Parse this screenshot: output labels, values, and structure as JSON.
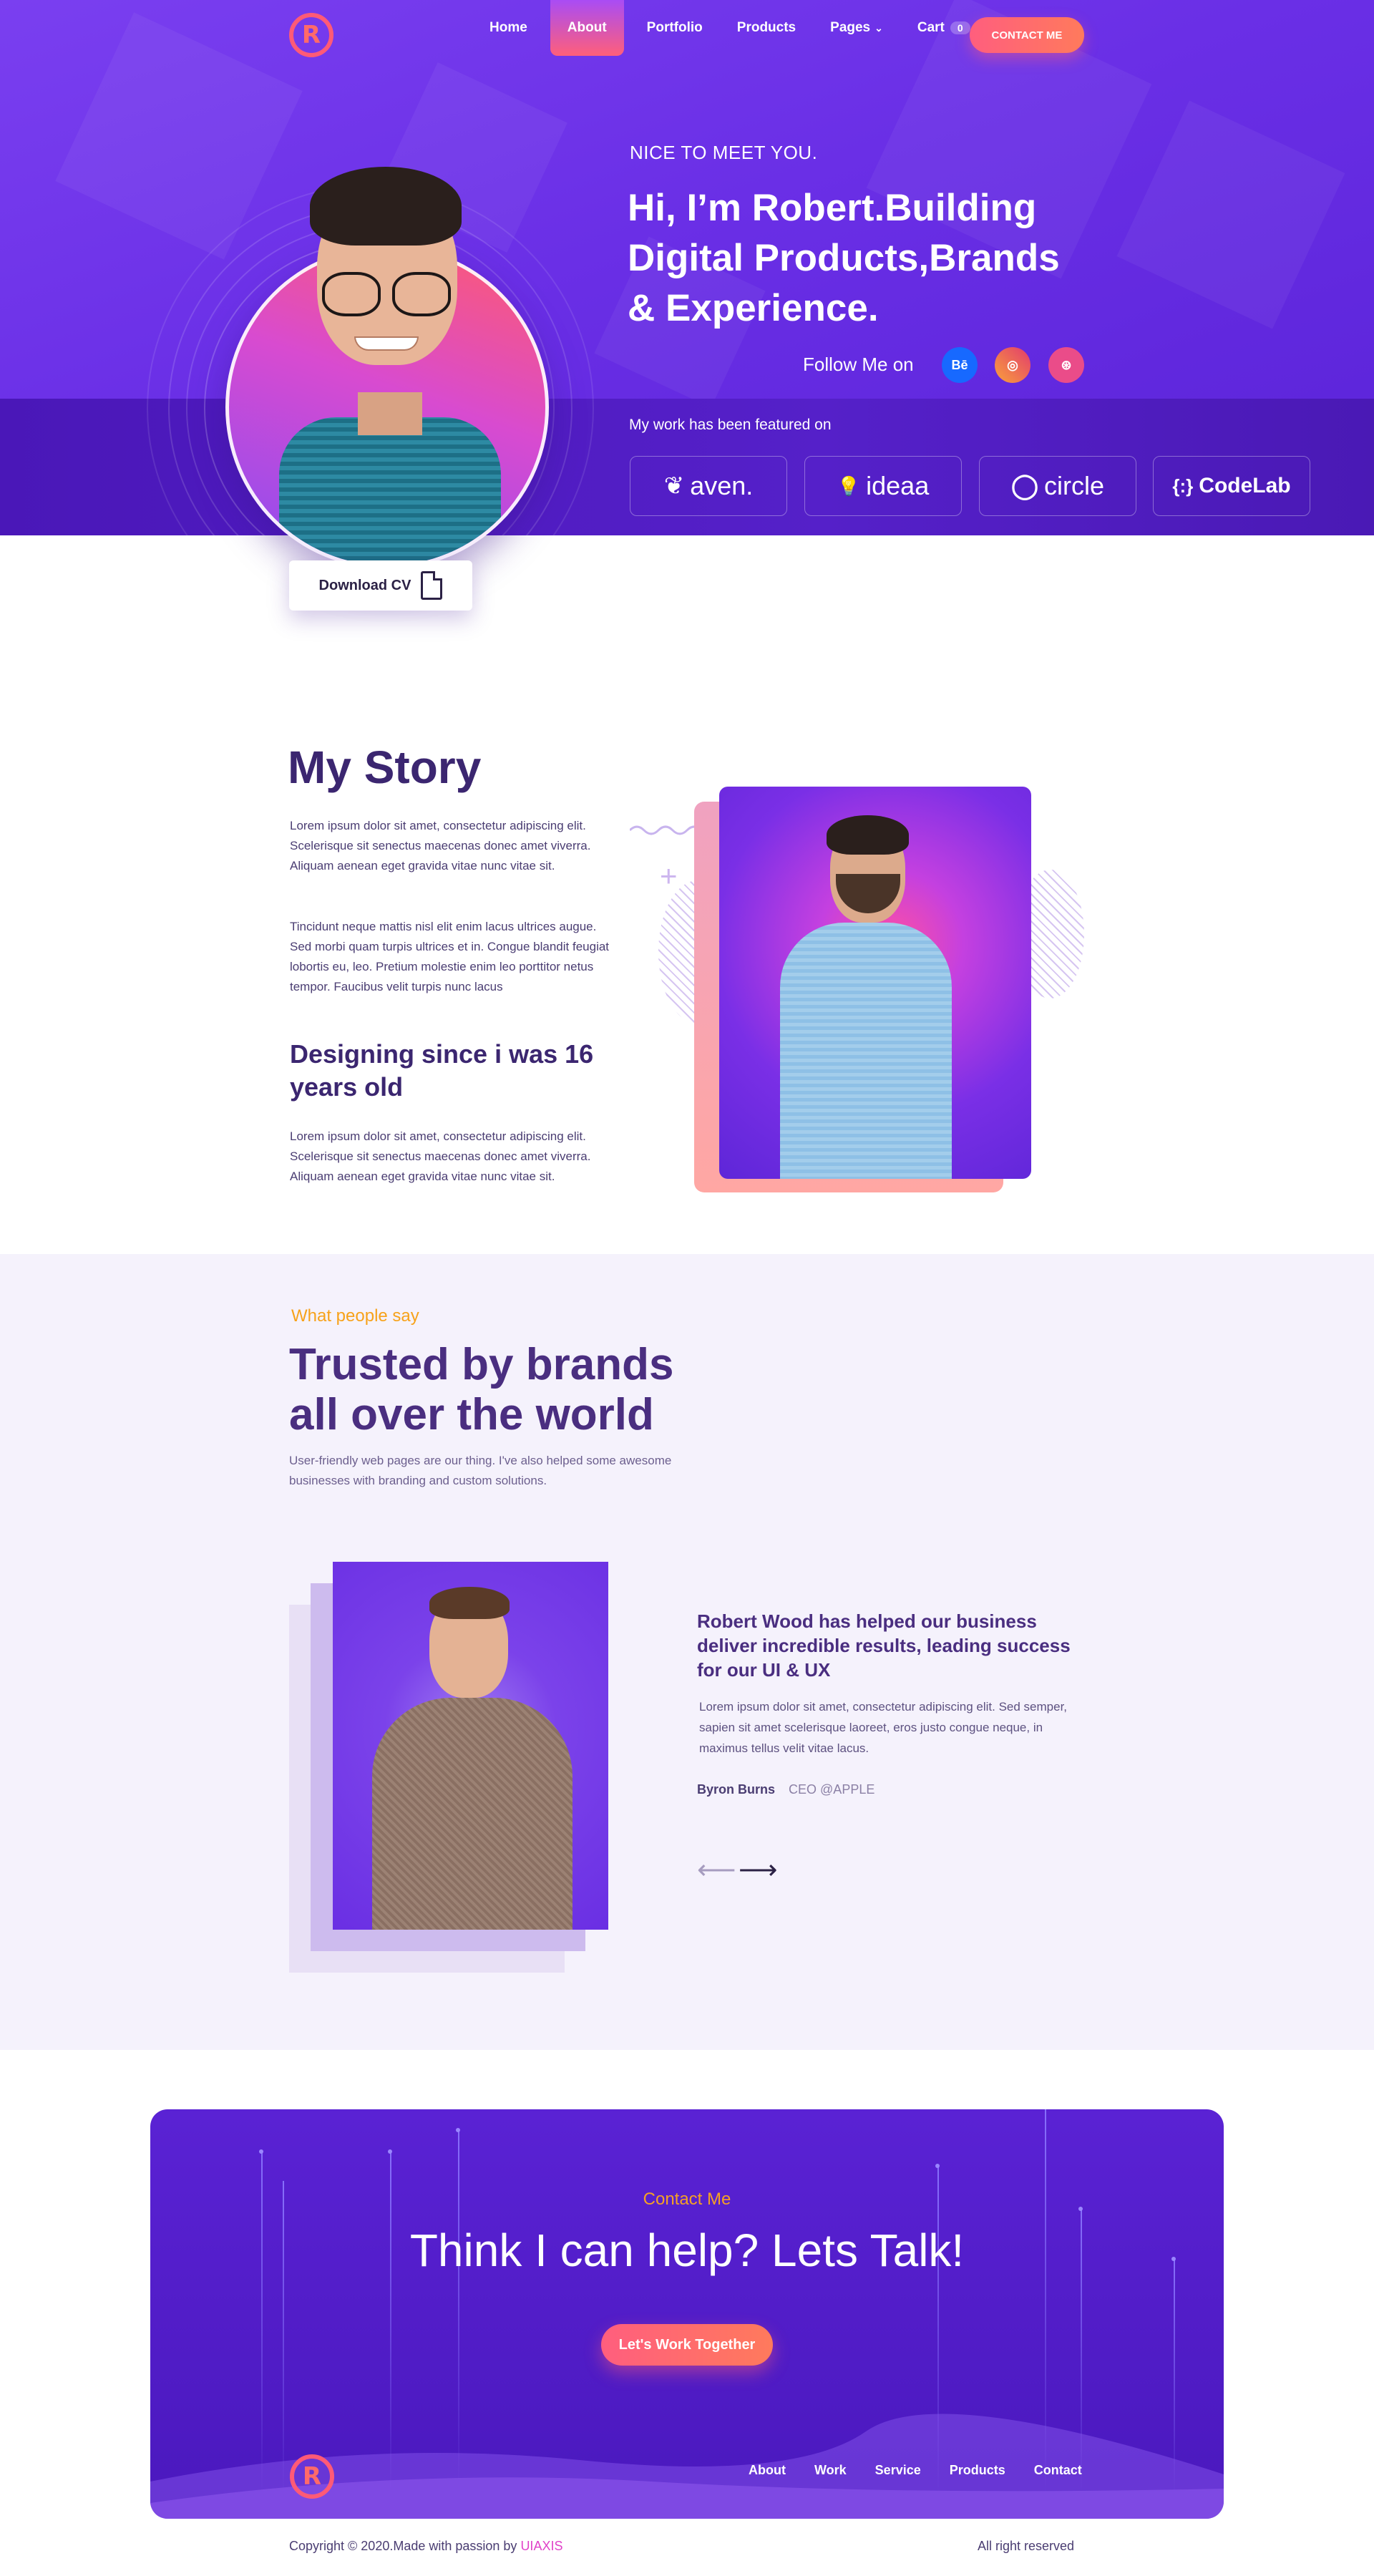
{
  "nav": {
    "items": [
      {
        "label": "Home"
      },
      {
        "label": "About"
      },
      {
        "label": "Portfolio"
      },
      {
        "label": "Products"
      },
      {
        "label": "Pages"
      },
      {
        "label": "Cart"
      }
    ],
    "cart_count": "0",
    "active": "About",
    "contact_button": "CONTACT ME"
  },
  "hero": {
    "subtitle": "NICE TO MEET YOU.",
    "title": "Hi, I’m Robert.Building Digital Products,Brands & Experience.",
    "follow_label": "Follow Me on",
    "socials": [
      {
        "icon": "behance-icon",
        "text": "Bē",
        "color": "#1769ff"
      },
      {
        "icon": "instagram-icon",
        "text": "◎",
        "color": "#f26d3d"
      },
      {
        "icon": "dribbble-icon",
        "text": "⊛",
        "color": "#ea4c89"
      }
    ],
    "featured_label": "My work has been featured on",
    "brands": [
      {
        "name": "aven.",
        "icon": "aven-logo-icon",
        "mark": "❦"
      },
      {
        "name": "ideaa",
        "icon": "ideaa-logo-icon",
        "mark": "💡"
      },
      {
        "name": "circle",
        "icon": "circle-logo-icon",
        "mark": "◯"
      },
      {
        "name": "CodeLab",
        "icon": "codelab-logo-icon",
        "mark": "{:}"
      }
    ],
    "download_cv": "Download CV"
  },
  "story": {
    "title": "My Story",
    "p1": "Lorem ipsum dolor sit amet, consectetur adipiscing elit. Scelerisque sit senectus maecenas donec amet viverra. Aliquam aenean eget gravida vitae nunc vitae sit.",
    "p2": "Tincidunt neque mattis nisl elit enim lacus ultrices augue. Sed morbi quam turpis ultrices et in. Congue blandit feugiat lobortis eu, leo. Pretium molestie enim leo porttitor netus tempor. Faucibus velit turpis nunc lacus",
    "subtitle": "Designing since i was 16 years old",
    "p3": "Lorem ipsum dolor sit amet, consectetur adipiscing elit. Scelerisque sit senectus maecenas donec amet viverra. Aliquam aenean eget gravida vitae nunc vitae sit."
  },
  "testimonials": {
    "label": "What people say",
    "title": "Trusted by brands all over the world",
    "subtitle": "User-friendly web pages are our thing. I've also helped some awesome businesses with branding and custom solutions.",
    "quote_title": "Robert Wood has helped our business deliver incredible results, leading success for our UI & UX",
    "quote_text": "Lorem ipsum dolor sit amet, consectetur adipiscing elit. Sed semper, sapien sit amet scelerisque laoreet, eros justo congue neque, in maximus tellus velit vitae lacus.",
    "author_name": "Byron Burns",
    "author_role": "CEO @APPLE",
    "prev_arrow": "⟵",
    "next_arrow": "⟶"
  },
  "contact": {
    "label": "Contact Me",
    "title": "Think I can help? Lets Talk!",
    "button": "Let's Work Together",
    "footer_nav": [
      "About",
      "Work",
      "Service",
      "Products",
      "Contact"
    ]
  },
  "footer": {
    "copyright": "Copyright © 2020.Made with passion by ",
    "brand": "UIAXIS",
    "rights": "All right reserved"
  },
  "logo_letter": "R",
  "colors": {
    "primary": "#6a2fe6",
    "accent": "#ff5e7e",
    "orange": "#f7a21a",
    "heading": "#3b2670"
  }
}
